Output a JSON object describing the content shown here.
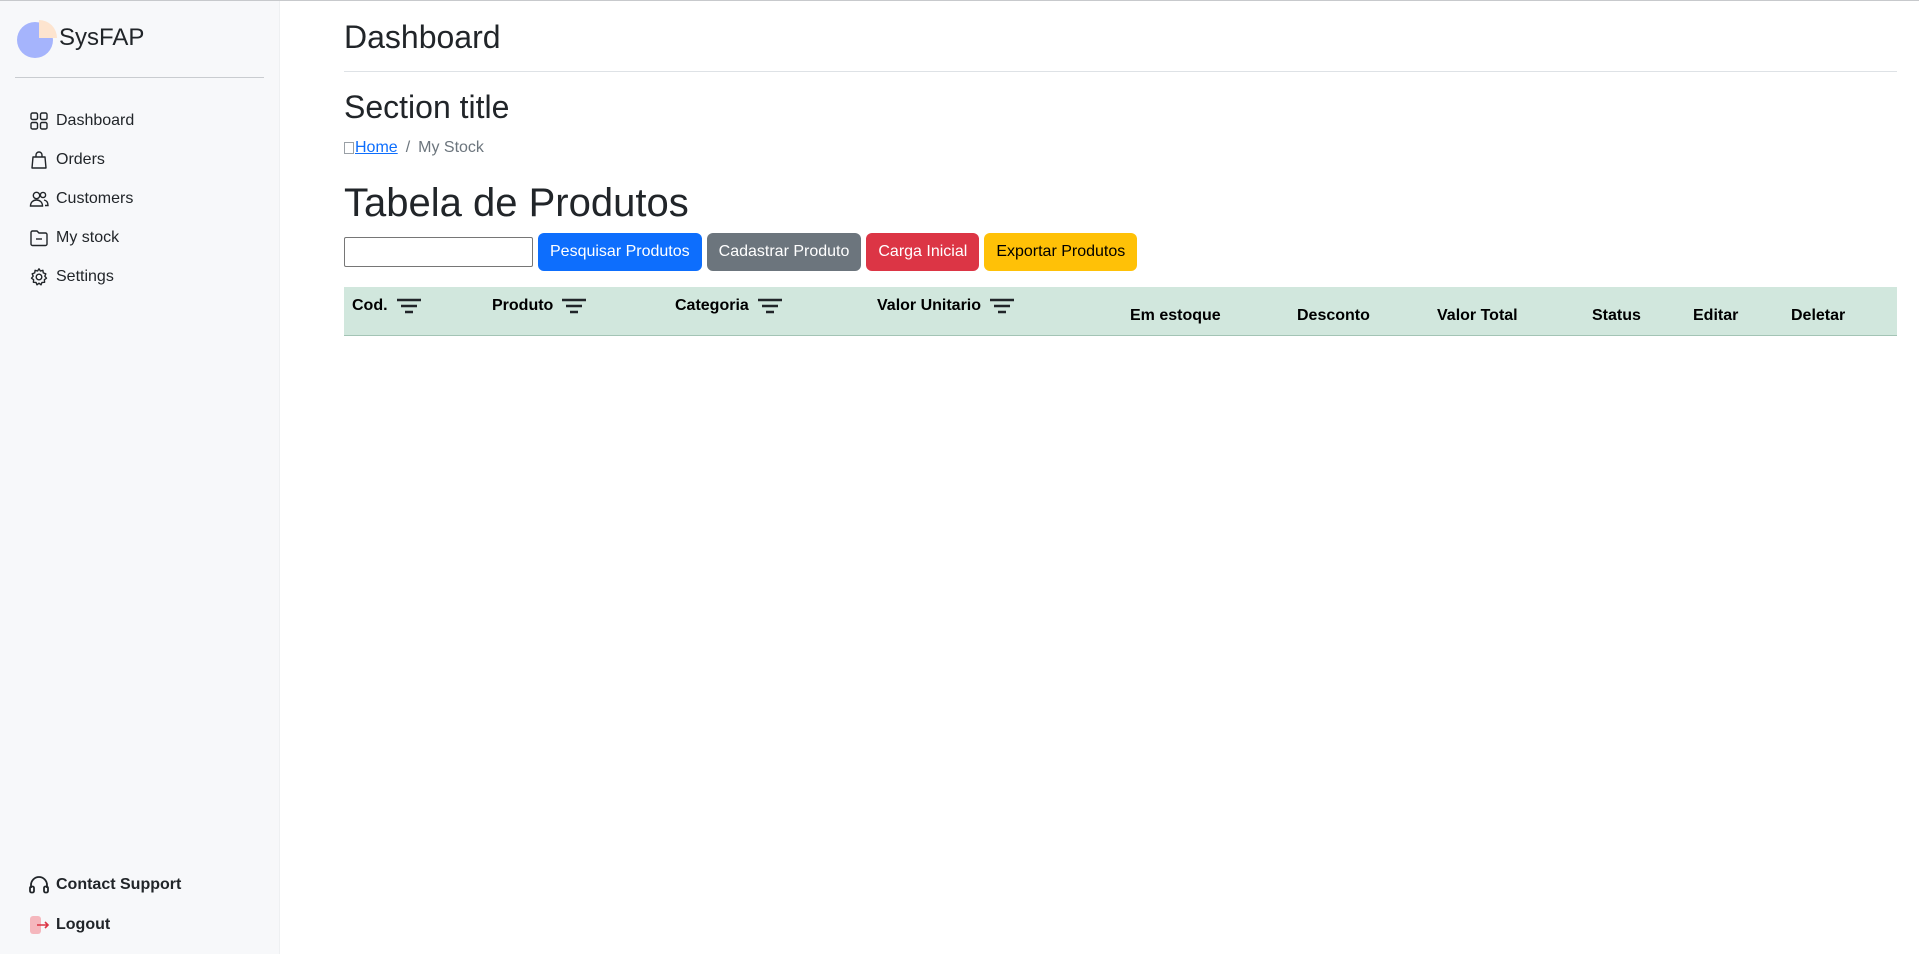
{
  "brand": {
    "name": "SysFAP",
    "logo_colors": {
      "main": "#a5b4fc",
      "slice": "#fde4cf"
    }
  },
  "sidebar": {
    "items": [
      {
        "label": "Dashboard",
        "icon": "grid-icon"
      },
      {
        "label": "Orders",
        "icon": "bag-icon"
      },
      {
        "label": "Customers",
        "icon": "people-icon"
      },
      {
        "label": "My stock",
        "icon": "folder-icon"
      },
      {
        "label": "Settings",
        "icon": "gear-icon"
      }
    ],
    "bottom": [
      {
        "label": "Contact Support",
        "icon": "headset-icon"
      },
      {
        "label": "Logout",
        "icon": "logout-icon"
      }
    ]
  },
  "header": {
    "title": "Dashboard"
  },
  "section": {
    "title": "Section title"
  },
  "breadcrumb": {
    "home": "Home",
    "separator": "/",
    "current": "My Stock"
  },
  "table_section": {
    "title": "Tabela de Produtos",
    "search": {
      "value": "",
      "placeholder": ""
    },
    "buttons": {
      "search": "Pesquisar Produtos",
      "register": "Cadastrar Produto",
      "initial_load": "Carga Inicial",
      "export": "Exportar Produtos"
    },
    "columns": [
      {
        "label": "Cod.",
        "filter": true
      },
      {
        "label": "Produto",
        "filter": true
      },
      {
        "label": "Categoria",
        "filter": true
      },
      {
        "label": "Valor Unitario",
        "filter": true
      },
      {
        "label": "Em estoque",
        "filter": false
      },
      {
        "label": "Desconto",
        "filter": false
      },
      {
        "label": "Valor Total",
        "filter": false
      },
      {
        "label": "Status",
        "filter": false
      },
      {
        "label": "Editar",
        "filter": false
      },
      {
        "label": "Deletar",
        "filter": false
      }
    ],
    "rows": []
  },
  "colors": {
    "primary": "#0d6efd",
    "secondary": "#6c757d",
    "danger": "#dc3545",
    "warning": "#ffc107",
    "table_header": "#d1e7dd"
  }
}
